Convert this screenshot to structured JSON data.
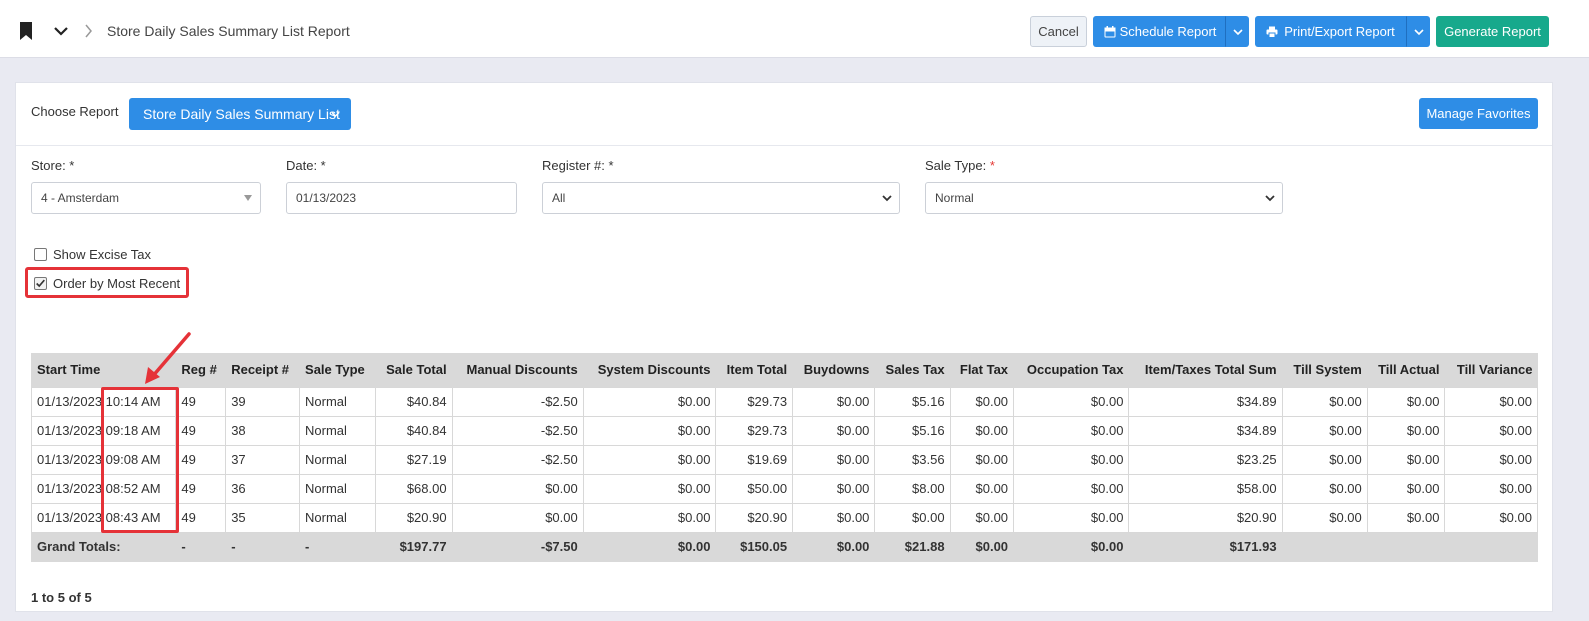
{
  "header": {
    "breadcrumb": "Store Daily Sales Summary List Report",
    "cancel_label": "Cancel",
    "schedule_label": "Schedule Report",
    "print_label": "Print/Export Report",
    "generate_label": "Generate Report"
  },
  "chooser": {
    "label": "Choose Report",
    "selected": "Store Daily Sales Summary List",
    "favorites_label": "Manage Favorites"
  },
  "filters": {
    "store": {
      "label": "Store: *",
      "value": "4 - Amsterdam"
    },
    "date": {
      "label": "Date: *",
      "value": "01/13/2023"
    },
    "register": {
      "label": "Register #: *",
      "value": "All"
    },
    "sale_type": {
      "label": "Sale Type: ",
      "required_mark": "*",
      "value": "Normal"
    },
    "show_excise": {
      "label": "Show Excise Tax",
      "checked": false
    },
    "order_recent": {
      "label": "Order by Most Recent",
      "checked": true
    }
  },
  "table": {
    "headers": [
      "Start Time",
      "Reg #",
      "Receipt #",
      "Sale Type",
      "Sale Total",
      "Manual Discounts",
      "System Discounts",
      "Item Total",
      "Buydowns",
      "Sales Tax",
      "Flat Tax",
      "Occupation Tax",
      "Item/Taxes Total Sum",
      "Till System",
      "Till Actual",
      "Till Variance"
    ],
    "rows": [
      [
        "01/13/2023 10:14 AM",
        "49",
        "39",
        "Normal",
        "$40.84",
        "-$2.50",
        "$0.00",
        "$29.73",
        "$0.00",
        "$5.16",
        "$0.00",
        "$0.00",
        "$34.89",
        "$0.00",
        "$0.00",
        "$0.00"
      ],
      [
        "01/13/2023 09:18 AM",
        "49",
        "38",
        "Normal",
        "$40.84",
        "-$2.50",
        "$0.00",
        "$29.73",
        "$0.00",
        "$5.16",
        "$0.00",
        "$0.00",
        "$34.89",
        "$0.00",
        "$0.00",
        "$0.00"
      ],
      [
        "01/13/2023 09:08 AM",
        "49",
        "37",
        "Normal",
        "$27.19",
        "-$2.50",
        "$0.00",
        "$19.69",
        "$0.00",
        "$3.56",
        "$0.00",
        "$0.00",
        "$23.25",
        "$0.00",
        "$0.00",
        "$0.00"
      ],
      [
        "01/13/2023 08:52 AM",
        "49",
        "36",
        "Normal",
        "$68.00",
        "$0.00",
        "$0.00",
        "$50.00",
        "$0.00",
        "$8.00",
        "$0.00",
        "$0.00",
        "$58.00",
        "$0.00",
        "$0.00",
        "$0.00"
      ],
      [
        "01/13/2023 08:43 AM",
        "49",
        "35",
        "Normal",
        "$20.90",
        "$0.00",
        "$0.00",
        "$20.90",
        "$0.00",
        "$0.00",
        "$0.00",
        "$0.00",
        "$20.90",
        "$0.00",
        "$0.00",
        "$0.00"
      ]
    ],
    "totals": [
      "Grand Totals:",
      "-",
      "-",
      "-",
      "$197.77",
      "-$7.50",
      "$0.00",
      "$150.05",
      "$0.00",
      "$21.88",
      "$0.00",
      "$0.00",
      "$171.93",
      "",
      "",
      ""
    ]
  },
  "pager": "1 to 5 of 5",
  "colors": {
    "primary": "#2e8de6",
    "success": "#17a98c",
    "annotation": "#e53238"
  }
}
